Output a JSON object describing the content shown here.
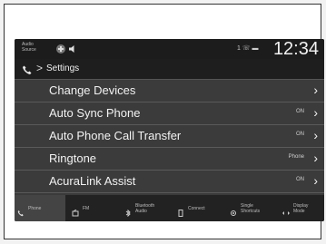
{
  "status": {
    "audio_label": "Audio Source",
    "time": "12:34",
    "system_icons": "1 ☏ ▬"
  },
  "breadcrumb": {
    "separator": ">",
    "title": "Settings"
  },
  "rows": [
    {
      "label": "Change Devices",
      "status": ""
    },
    {
      "label": "Auto Sync Phone",
      "status": "ON"
    },
    {
      "label": "Auto Phone Call Transfer",
      "status": "ON"
    },
    {
      "label": "Ringtone",
      "status": "Phone"
    },
    {
      "label": "AcuraLink Assist",
      "status": "ON"
    }
  ],
  "tabs": [
    {
      "label": "Phone",
      "icon": "phone-icon"
    },
    {
      "label": "FM",
      "icon": "radio-icon"
    },
    {
      "label": "Bluetooth Audio",
      "icon": "bluetooth-icon"
    },
    {
      "label": "Connect",
      "icon": "device-icon"
    },
    {
      "label": "Single Shortcuts",
      "icon": "shortcut-icon"
    },
    {
      "label": "Display Mode",
      "icon": "display-icon"
    }
  ],
  "colors": {
    "screen_bg": "#3a3a3a",
    "statusbar_bg": "#1c1c1c",
    "tab_active": "#444444"
  }
}
